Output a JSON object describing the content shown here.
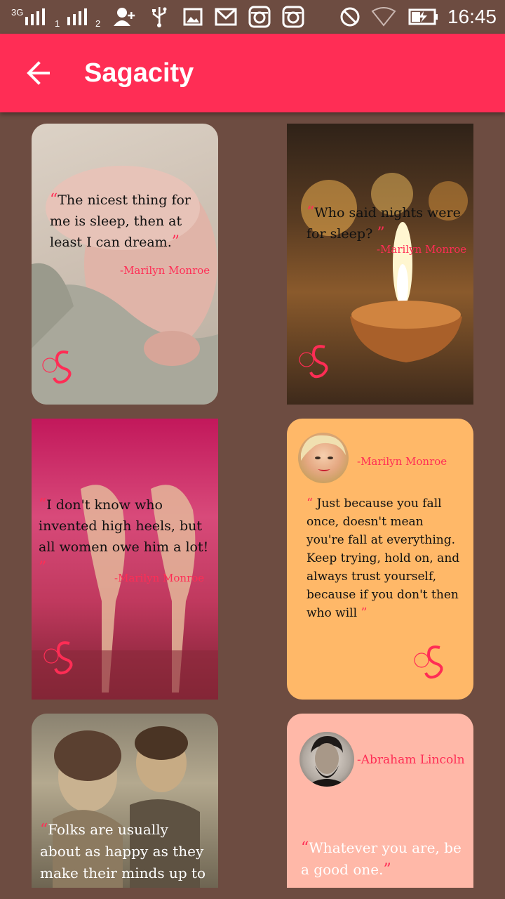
{
  "status_bar": {
    "network_label": "3G",
    "sim1": "1",
    "sim2": "2",
    "time": "16:45"
  },
  "app_bar": {
    "title": "Sagacity",
    "back_icon": "arrow-left-icon"
  },
  "logo_text": "Sagacity",
  "colors": {
    "background": "#6d4c41",
    "accent": "#ff2d55",
    "card_orange": "#ffb868",
    "card_peach": "#ffb8a8"
  },
  "cards": [
    {
      "quote": "The nicest thing for me is sleep, then at least I can dream.",
      "author": "-Marilyn Monroe"
    },
    {
      "quote": "Who said nights were for sleep?",
      "author": "-Marilyn Monroe"
    },
    {
      "quote": "I don't know who invented high heels, but all women owe him a lot!",
      "author": "-Marilyn Monroe"
    },
    {
      "quote": "Just because you fall once, doesn't mean you're fall at everything. Keep trying, hold on, and always trust yourself, because if you don't then who will",
      "author": "-Marilyn Monroe"
    },
    {
      "quote": "Folks are usually about as happy as they make their minds up to be.",
      "author": ""
    },
    {
      "quote": "Whatever you are, be a good one.",
      "author": "-Abraham Lincoln"
    }
  ]
}
